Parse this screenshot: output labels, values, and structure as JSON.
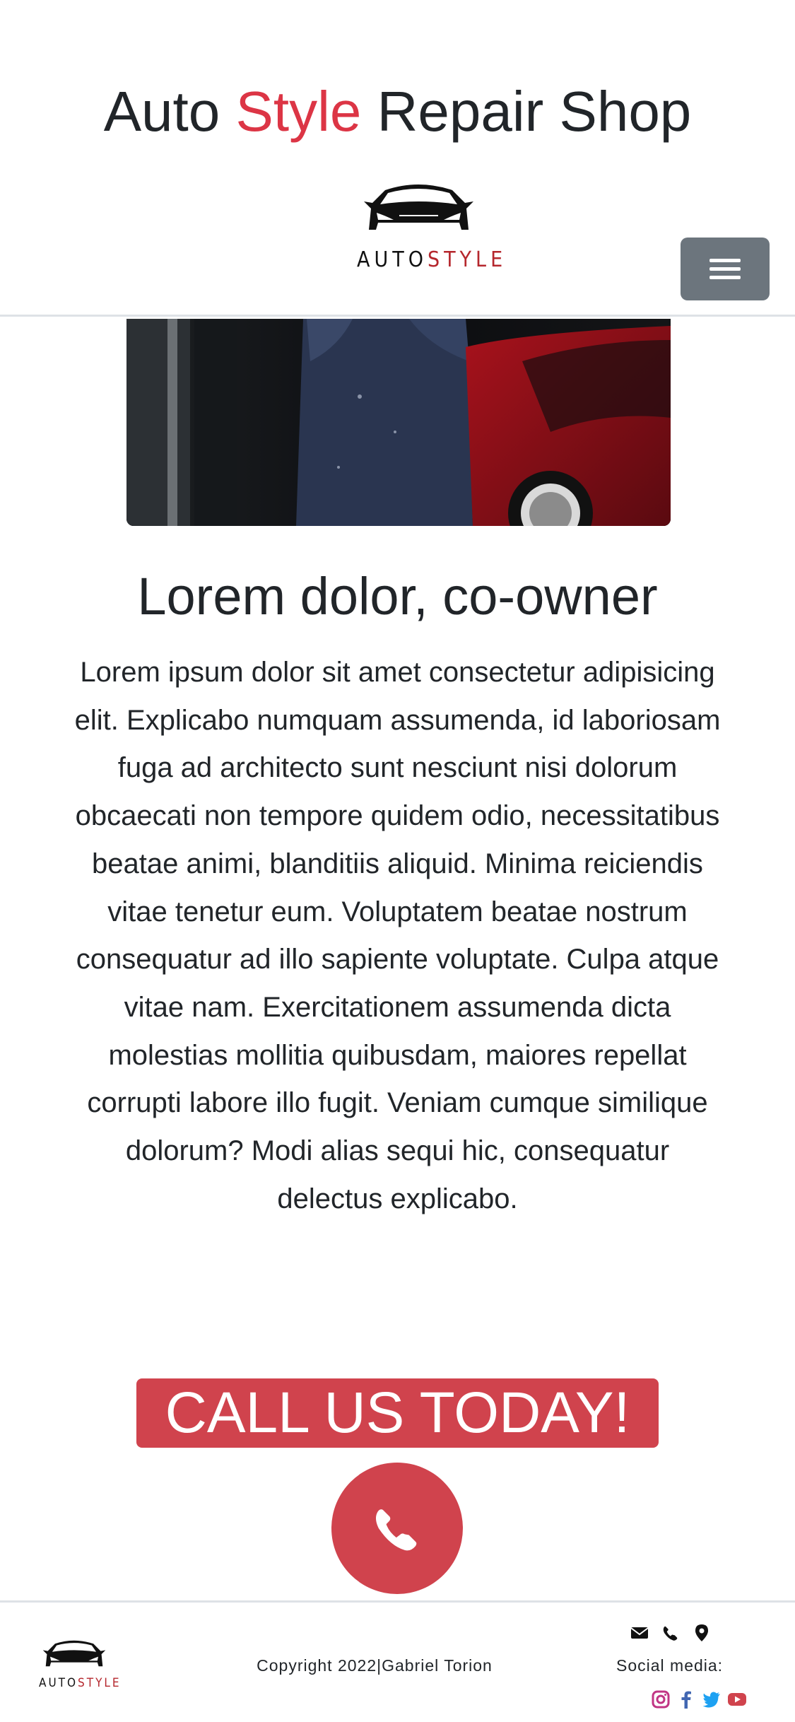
{
  "header": {
    "title_part1": "Auto ",
    "title_accent": "Style",
    "title_part2": " Repair Shop",
    "logo_text_auto": "AUTO",
    "logo_text_style": "STYLE",
    "menu_icon": "hamburger-icon"
  },
  "hero": {
    "image_subject": "mechanic-next-to-red-car"
  },
  "content": {
    "heading": "Lorem dolor, co-owner",
    "bio": "Lorem ipsum dolor sit amet consectetur adipisicing elit. Explicabo numquam assumenda, id laboriosam fuga ad architecto sunt nesciunt nisi dolorum obcaecati non tempore quidem odio, necessitatibus beatae animi, blanditiis aliquid. Minima reiciendis vitae tenetur eum. Voluptatem beatae nostrum consequatur ad illo sapiente voluptate. Culpa atque vitae nam. Exercitationem assumenda dicta molestias mollitia quibusdam, maiores repellat corrupti labore illo fugit. Veniam cumque similique dolorum? Modi alias sequi hic, consequatur delectus explicabo.",
    "call_banner": "CALL US TODAY!",
    "call_icon": "phone-icon"
  },
  "footer": {
    "logo_text_auto": "AUTO",
    "logo_text_style": "STYLE",
    "copyright": "Copyright 2022|Gabriel Torion",
    "contact_icons": [
      "envelope-icon",
      "phone-icon",
      "map-pin-icon"
    ],
    "social_label": "Social media:",
    "social_icons": [
      "instagram-icon",
      "facebook-icon",
      "twitter-icon",
      "youtube-icon"
    ]
  },
  "colors": {
    "accent": "#dc3545",
    "button_red": "#d0434d",
    "menu_button": "#6c757d",
    "text": "#212529",
    "instagram": "#c13584",
    "facebook": "#4267b2",
    "twitter": "#1da1f2",
    "youtube": "#d0434d"
  }
}
